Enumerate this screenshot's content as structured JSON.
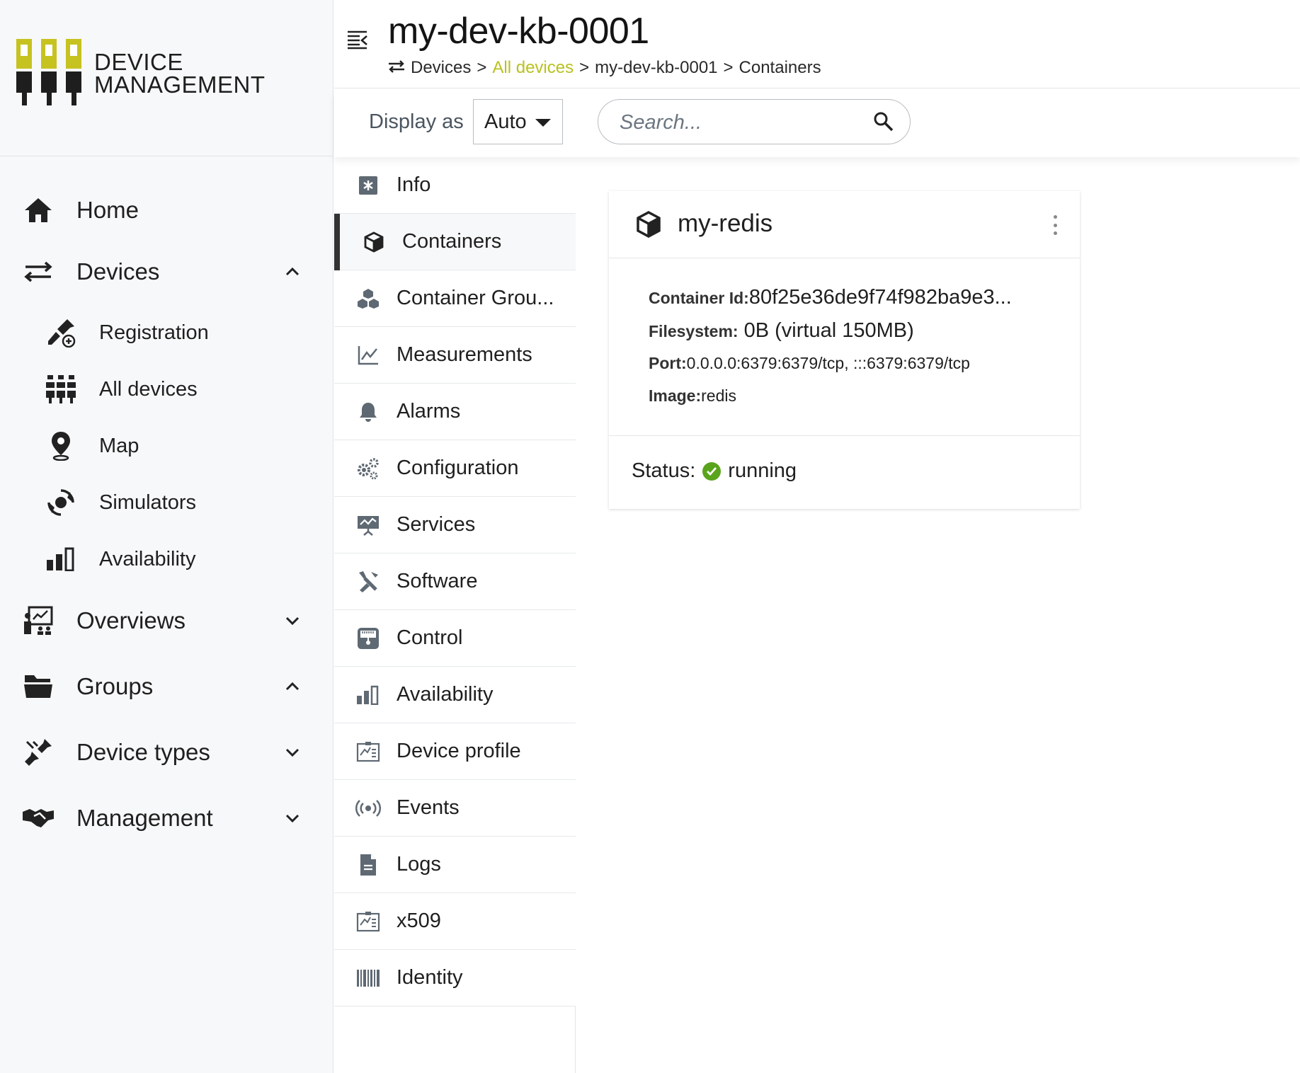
{
  "brand": {
    "line1": "DEVICE",
    "line2": "MANAGEMENT",
    "accent_color": "#c6c220"
  },
  "sidebar": {
    "items": [
      {
        "label": "Home",
        "icon": "home-icon"
      },
      {
        "label": "Devices",
        "icon": "swap-arrows-icon",
        "expanded": true
      },
      {
        "label": "Registration",
        "icon": "plug-add-icon"
      },
      {
        "label": "All devices",
        "icon": "devices-grid-icon"
      },
      {
        "label": "Map",
        "icon": "map-pin-icon"
      },
      {
        "label": "Simulators",
        "icon": "simulator-icon"
      },
      {
        "label": "Availability",
        "icon": "bar-chart-icon"
      },
      {
        "label": "Overviews",
        "icon": "presentation-icon",
        "expanded": false
      },
      {
        "label": "Groups",
        "icon": "folder-icon",
        "expanded": true
      },
      {
        "label": "Device types",
        "icon": "plugs-icon",
        "expanded": false
      },
      {
        "label": "Management",
        "icon": "handshake-icon",
        "expanded": false
      }
    ]
  },
  "header": {
    "title": "my-dev-kb-0001",
    "breadcrumb": {
      "devices": "Devices",
      "all_devices": "All devices",
      "device": "my-dev-kb-0001",
      "current": "Containers",
      "sep": ">"
    }
  },
  "toolbar": {
    "display_label": "Display as",
    "display_value": "Auto",
    "search_placeholder": "Search..."
  },
  "tabs": [
    {
      "label": "Info",
      "icon": "info-icon"
    },
    {
      "label": "Containers",
      "icon": "cube-icon",
      "active": true
    },
    {
      "label": "Container Grou...",
      "icon": "cubes-icon"
    },
    {
      "label": "Measurements",
      "icon": "line-chart-icon"
    },
    {
      "label": "Alarms",
      "icon": "bell-icon"
    },
    {
      "label": "Configuration",
      "icon": "gears-icon"
    },
    {
      "label": "Services",
      "icon": "services-icon"
    },
    {
      "label": "Software",
      "icon": "software-icon"
    },
    {
      "label": "Control",
      "icon": "control-icon"
    },
    {
      "label": "Availability",
      "icon": "bar-chart-icon"
    },
    {
      "label": "Device profile",
      "icon": "profile-icon"
    },
    {
      "label": "Events",
      "icon": "broadcast-icon"
    },
    {
      "label": "Logs",
      "icon": "document-icon"
    },
    {
      "label": "x509",
      "icon": "certificate-icon"
    },
    {
      "label": "Identity",
      "icon": "barcode-icon"
    }
  ],
  "container": {
    "name": "my-redis",
    "container_id_label": "Container Id:",
    "container_id": "80f25e36de9f74f982ba9e3...",
    "filesystem_label": "Filesystem:",
    "filesystem": "0B (virtual 150MB)",
    "port_label": "Port:",
    "port": "0.0.0.0:6379:6379/tcp, :::6379:6379/tcp",
    "image_label": "Image:",
    "image": "redis",
    "status_label": "Status:",
    "status": "running",
    "status_color": "#5aa41d"
  }
}
